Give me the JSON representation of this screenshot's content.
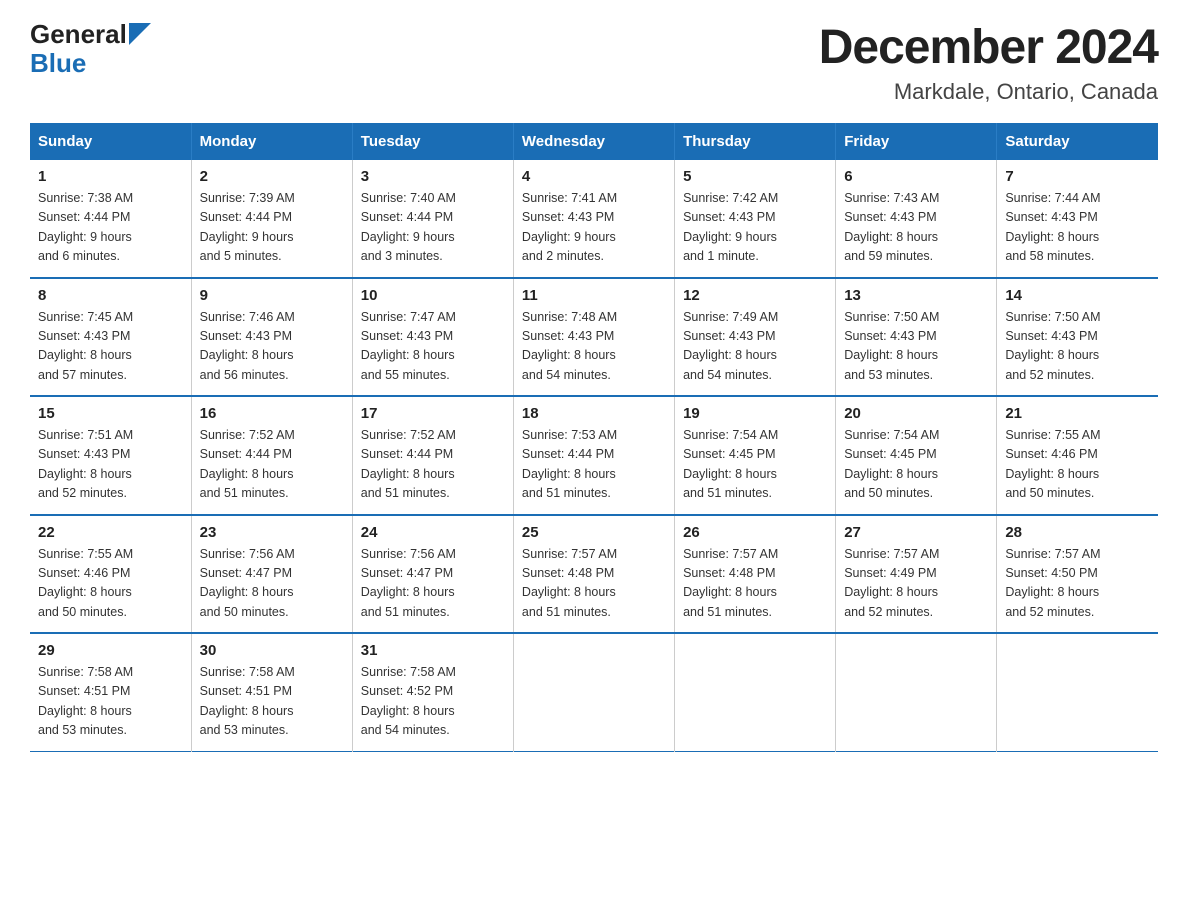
{
  "logo": {
    "general": "General",
    "blue": "Blue"
  },
  "title": "December 2024",
  "subtitle": "Markdale, Ontario, Canada",
  "days_of_week": [
    "Sunday",
    "Monday",
    "Tuesday",
    "Wednesday",
    "Thursday",
    "Friday",
    "Saturday"
  ],
  "weeks": [
    [
      {
        "day": "1",
        "sunrise": "7:38 AM",
        "sunset": "4:44 PM",
        "daylight": "9 hours and 6 minutes."
      },
      {
        "day": "2",
        "sunrise": "7:39 AM",
        "sunset": "4:44 PM",
        "daylight": "9 hours and 5 minutes."
      },
      {
        "day": "3",
        "sunrise": "7:40 AM",
        "sunset": "4:44 PM",
        "daylight": "9 hours and 3 minutes."
      },
      {
        "day": "4",
        "sunrise": "7:41 AM",
        "sunset": "4:43 PM",
        "daylight": "9 hours and 2 minutes."
      },
      {
        "day": "5",
        "sunrise": "7:42 AM",
        "sunset": "4:43 PM",
        "daylight": "9 hours and 1 minute."
      },
      {
        "day": "6",
        "sunrise": "7:43 AM",
        "sunset": "4:43 PM",
        "daylight": "8 hours and 59 minutes."
      },
      {
        "day": "7",
        "sunrise": "7:44 AM",
        "sunset": "4:43 PM",
        "daylight": "8 hours and 58 minutes."
      }
    ],
    [
      {
        "day": "8",
        "sunrise": "7:45 AM",
        "sunset": "4:43 PM",
        "daylight": "8 hours and 57 minutes."
      },
      {
        "day": "9",
        "sunrise": "7:46 AM",
        "sunset": "4:43 PM",
        "daylight": "8 hours and 56 minutes."
      },
      {
        "day": "10",
        "sunrise": "7:47 AM",
        "sunset": "4:43 PM",
        "daylight": "8 hours and 55 minutes."
      },
      {
        "day": "11",
        "sunrise": "7:48 AM",
        "sunset": "4:43 PM",
        "daylight": "8 hours and 54 minutes."
      },
      {
        "day": "12",
        "sunrise": "7:49 AM",
        "sunset": "4:43 PM",
        "daylight": "8 hours and 54 minutes."
      },
      {
        "day": "13",
        "sunrise": "7:50 AM",
        "sunset": "4:43 PM",
        "daylight": "8 hours and 53 minutes."
      },
      {
        "day": "14",
        "sunrise": "7:50 AM",
        "sunset": "4:43 PM",
        "daylight": "8 hours and 52 minutes."
      }
    ],
    [
      {
        "day": "15",
        "sunrise": "7:51 AM",
        "sunset": "4:43 PM",
        "daylight": "8 hours and 52 minutes."
      },
      {
        "day": "16",
        "sunrise": "7:52 AM",
        "sunset": "4:44 PM",
        "daylight": "8 hours and 51 minutes."
      },
      {
        "day": "17",
        "sunrise": "7:52 AM",
        "sunset": "4:44 PM",
        "daylight": "8 hours and 51 minutes."
      },
      {
        "day": "18",
        "sunrise": "7:53 AM",
        "sunset": "4:44 PM",
        "daylight": "8 hours and 51 minutes."
      },
      {
        "day": "19",
        "sunrise": "7:54 AM",
        "sunset": "4:45 PM",
        "daylight": "8 hours and 51 minutes."
      },
      {
        "day": "20",
        "sunrise": "7:54 AM",
        "sunset": "4:45 PM",
        "daylight": "8 hours and 50 minutes."
      },
      {
        "day": "21",
        "sunrise": "7:55 AM",
        "sunset": "4:46 PM",
        "daylight": "8 hours and 50 minutes."
      }
    ],
    [
      {
        "day": "22",
        "sunrise": "7:55 AM",
        "sunset": "4:46 PM",
        "daylight": "8 hours and 50 minutes."
      },
      {
        "day": "23",
        "sunrise": "7:56 AM",
        "sunset": "4:47 PM",
        "daylight": "8 hours and 50 minutes."
      },
      {
        "day": "24",
        "sunrise": "7:56 AM",
        "sunset": "4:47 PM",
        "daylight": "8 hours and 51 minutes."
      },
      {
        "day": "25",
        "sunrise": "7:57 AM",
        "sunset": "4:48 PM",
        "daylight": "8 hours and 51 minutes."
      },
      {
        "day": "26",
        "sunrise": "7:57 AM",
        "sunset": "4:48 PM",
        "daylight": "8 hours and 51 minutes."
      },
      {
        "day": "27",
        "sunrise": "7:57 AM",
        "sunset": "4:49 PM",
        "daylight": "8 hours and 52 minutes."
      },
      {
        "day": "28",
        "sunrise": "7:57 AM",
        "sunset": "4:50 PM",
        "daylight": "8 hours and 52 minutes."
      }
    ],
    [
      {
        "day": "29",
        "sunrise": "7:58 AM",
        "sunset": "4:51 PM",
        "daylight": "8 hours and 53 minutes."
      },
      {
        "day": "30",
        "sunrise": "7:58 AM",
        "sunset": "4:51 PM",
        "daylight": "8 hours and 53 minutes."
      },
      {
        "day": "31",
        "sunrise": "7:58 AM",
        "sunset": "4:52 PM",
        "daylight": "8 hours and 54 minutes."
      },
      null,
      null,
      null,
      null
    ]
  ]
}
